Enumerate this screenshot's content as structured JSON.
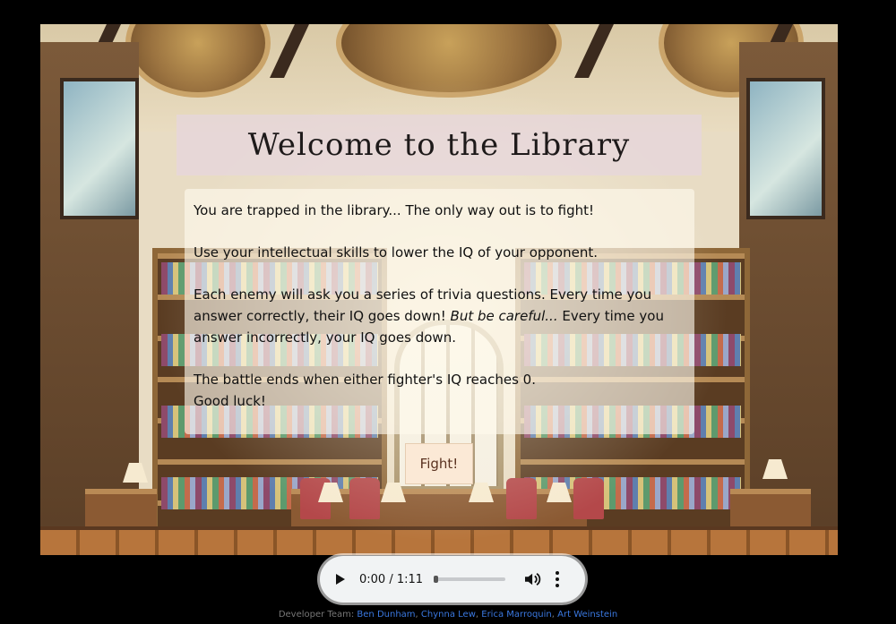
{
  "title": "Welcome to the Library",
  "intro": {
    "p1": "You are trapped in the library... The only way out is to fight!",
    "p2": "Use your intellectual skills to lower the IQ of your opponent.",
    "p3_start": "Each enemy will ask you a series of trivia questions. Every time you answer correctly, their IQ goes down! ",
    "p3_emphasis": "But be careful...",
    "p3_end": " Every time you answer incorrectly, your IQ goes down.",
    "p4_line1": "The battle ends when either fighter's IQ reaches 0.",
    "p4_line2": "Good luck!"
  },
  "fight_button": "Fight!",
  "audio": {
    "time": "0:00 / 1:11",
    "progress": 0,
    "icons": [
      "play-icon",
      "volume-icon",
      "more-options-icon"
    ]
  },
  "credits": {
    "label": "Developer Team:",
    "members": [
      "Ben Dunham",
      "Chynna Lew",
      "Erica Marroquin",
      "Art Weinstein"
    ],
    "separator": ","
  },
  "colors": {
    "background": "#000000",
    "title_box": "#e6d6de",
    "info_box": "#fffaee",
    "fight_button": "#fbe9d6",
    "link": "#3a78e0"
  }
}
